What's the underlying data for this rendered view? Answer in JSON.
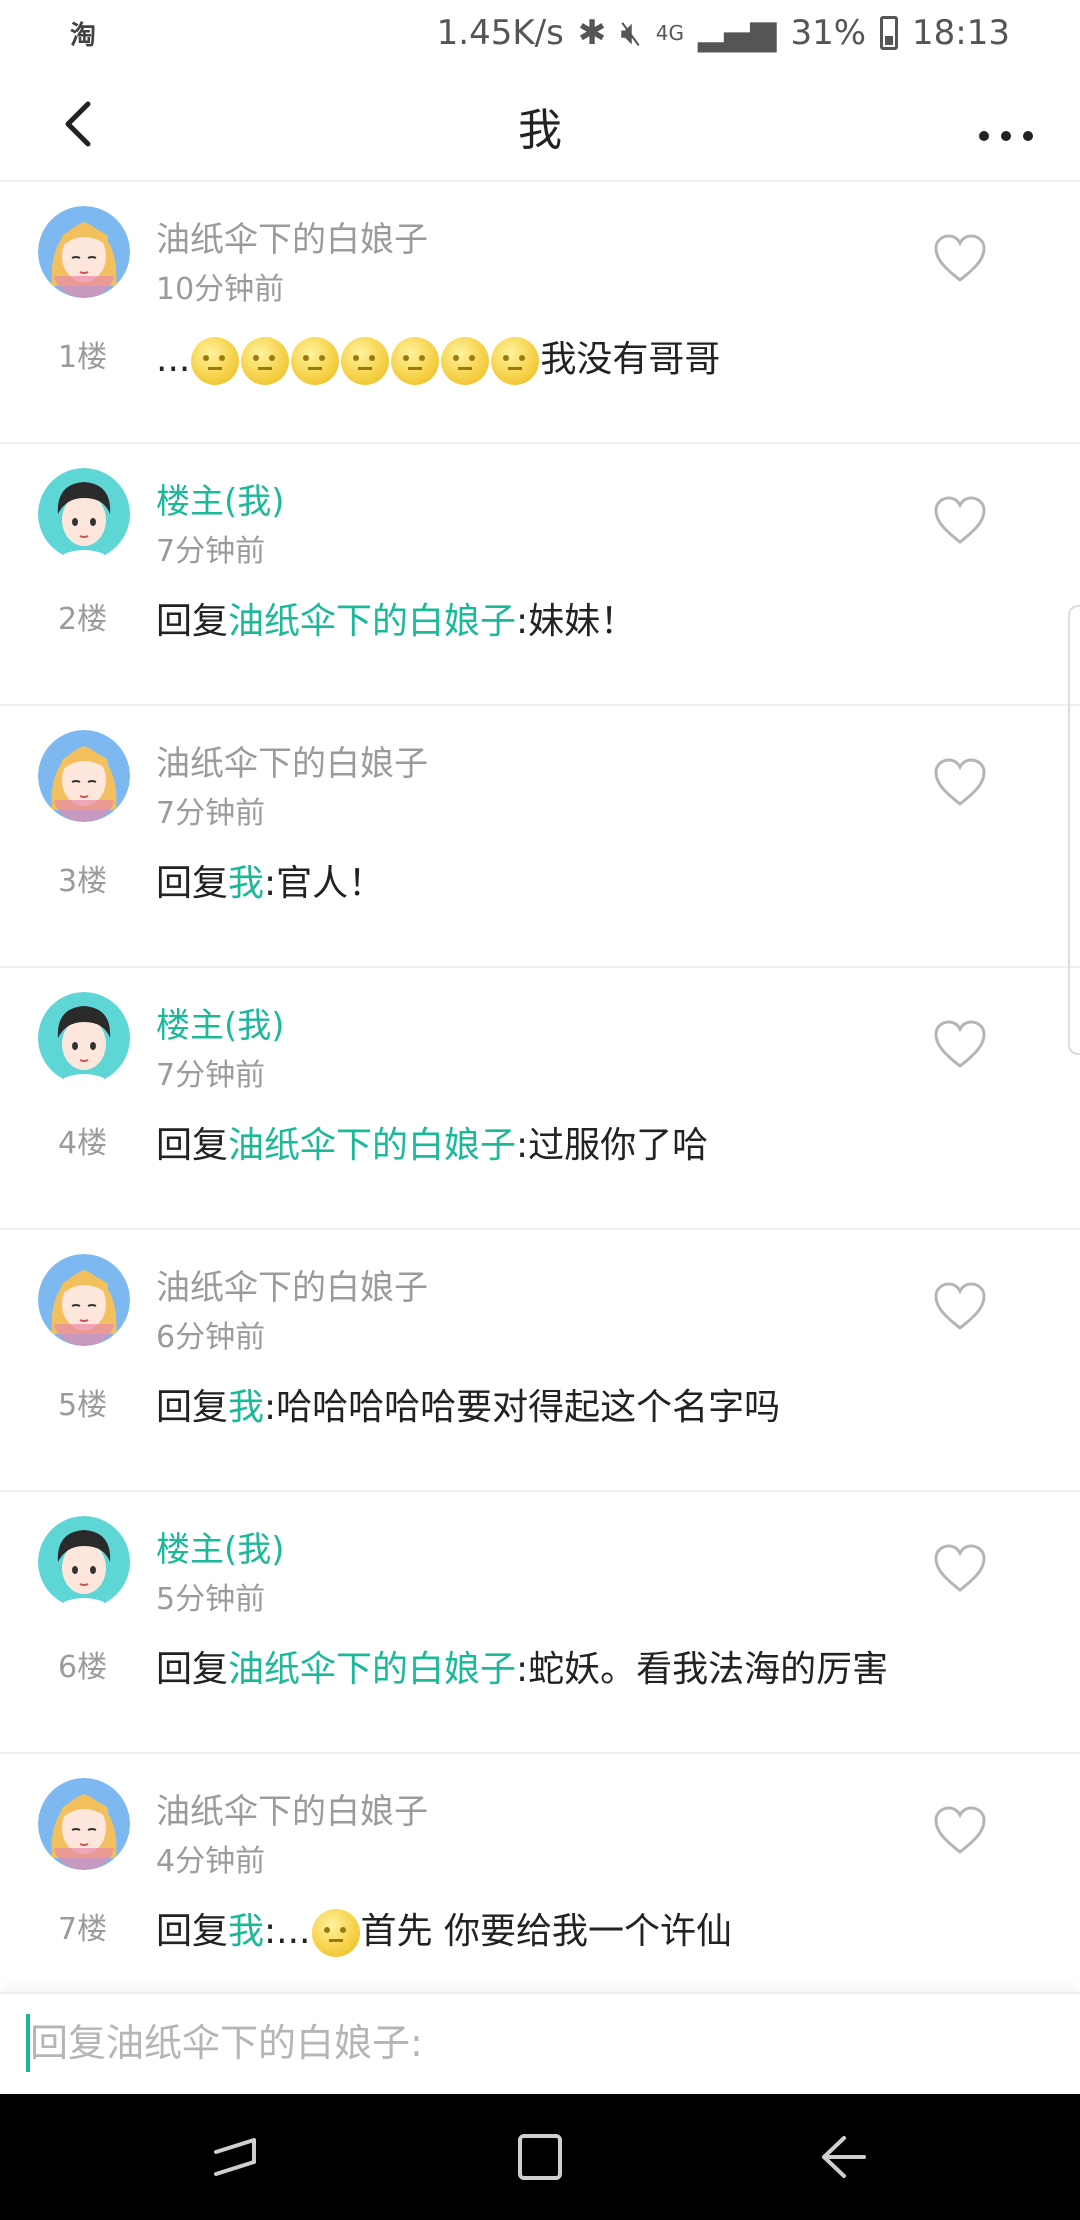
{
  "status_bar": {
    "app_icon": "淘",
    "network_speed": "1.45K/s",
    "battery": "31%",
    "time": "18:13",
    "icons": [
      "bluetooth-icon",
      "mute-icon",
      "4g-icon",
      "signal-icon",
      "battery-icon"
    ]
  },
  "header": {
    "back_icon": "back-chevron-icon",
    "title": "我",
    "more_icon": "more-dots-icon"
  },
  "colors": {
    "accent": "#1cb89a",
    "muted_text": "#9b9b9b",
    "body_text": "#222222"
  },
  "floors": [
    {
      "avatar": "girl-avatar",
      "name": "油纸伞下的白娘子",
      "is_host": false,
      "time": "10分钟前",
      "floor": "1楼",
      "prefix": "",
      "mention": "",
      "sep": "",
      "before_emoji": "...",
      "emoji_count": 7,
      "text": "我没有哥哥"
    },
    {
      "avatar": "boy-avatar",
      "name": "楼主(我)",
      "is_host": true,
      "time": "7分钟前",
      "floor": "2楼",
      "prefix": "回复",
      "mention": "油纸伞下的白娘子",
      "sep": ":",
      "before_emoji": "",
      "emoji_count": 0,
      "text": "妹妹！"
    },
    {
      "avatar": "girl-avatar",
      "name": "油纸伞下的白娘子",
      "is_host": false,
      "time": "7分钟前",
      "floor": "3楼",
      "prefix": "回复",
      "mention": "我",
      "sep": ":",
      "before_emoji": "",
      "emoji_count": 0,
      "text": "官人！"
    },
    {
      "avatar": "boy-avatar",
      "name": "楼主(我)",
      "is_host": true,
      "time": "7分钟前",
      "floor": "4楼",
      "prefix": "回复",
      "mention": "油纸伞下的白娘子",
      "sep": ":",
      "before_emoji": "",
      "emoji_count": 0,
      "text": "过服你了哈"
    },
    {
      "avatar": "girl-avatar",
      "name": "油纸伞下的白娘子",
      "is_host": false,
      "time": "6分钟前",
      "floor": "5楼",
      "prefix": "回复",
      "mention": "我",
      "sep": ":",
      "before_emoji": "",
      "emoji_count": 0,
      "text": "哈哈哈哈哈要对得起这个名字吗"
    },
    {
      "avatar": "boy-avatar",
      "name": "楼主(我)",
      "is_host": true,
      "time": "5分钟前",
      "floor": "6楼",
      "prefix": "回复",
      "mention": "油纸伞下的白娘子",
      "sep": ":",
      "before_emoji": "",
      "emoji_count": 0,
      "text": "蛇妖。看我法海的厉害"
    },
    {
      "avatar": "girl-avatar",
      "name": "油纸伞下的白娘子",
      "is_host": false,
      "time": "4分钟前",
      "floor": "7楼",
      "prefix": "回复",
      "mention": "我",
      "sep": ":",
      "before_emoji": "...",
      "emoji_count": 1,
      "text": "首先 你要给我一个许仙"
    }
  ],
  "reply_box": {
    "placeholder": "回复油纸伞下的白娘子:",
    "value": ""
  },
  "nav_bar": {
    "buttons": [
      "recent-apps-icon",
      "home-icon",
      "back-icon"
    ]
  }
}
